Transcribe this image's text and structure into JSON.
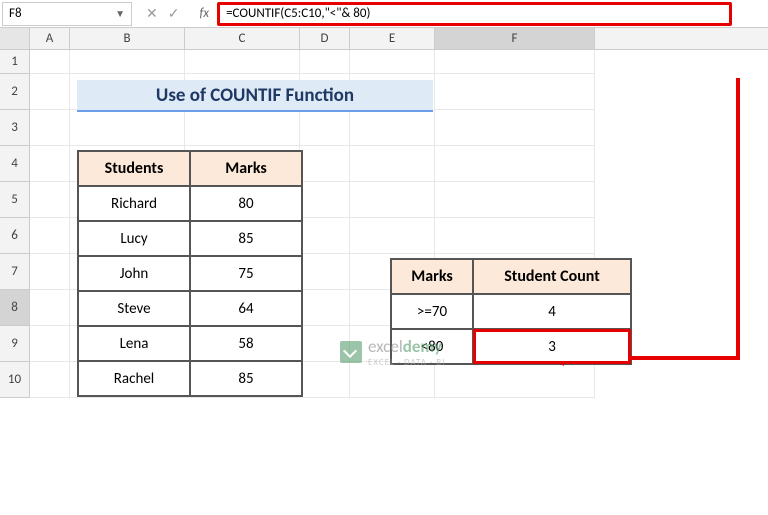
{
  "name_box": "F8",
  "formula": "=COUNTIF(C5:C10,\"<\"& 80)",
  "columns": [
    "A",
    "B",
    "C",
    "D",
    "E",
    "F"
  ],
  "rows": [
    "1",
    "2",
    "3",
    "4",
    "5",
    "6",
    "7",
    "8",
    "9",
    "10"
  ],
  "title": "Use of COUNTIF Function",
  "data_table": {
    "headers": [
      "Students",
      "Marks"
    ],
    "rows": [
      [
        "Richard",
        "80"
      ],
      [
        "Lucy",
        "85"
      ],
      [
        "John",
        "75"
      ],
      [
        "Steve",
        "64"
      ],
      [
        "Lena",
        "58"
      ],
      [
        "Rachel",
        "85"
      ]
    ]
  },
  "count_table": {
    "headers": [
      "Marks",
      "Student Count"
    ],
    "rows": [
      [
        ">=70",
        "4"
      ],
      [
        "<80",
        "3"
      ]
    ]
  },
  "watermark": {
    "brand_a": "excel",
    "brand_b": "demy",
    "sub": "EXCEL · DATA · BI"
  }
}
